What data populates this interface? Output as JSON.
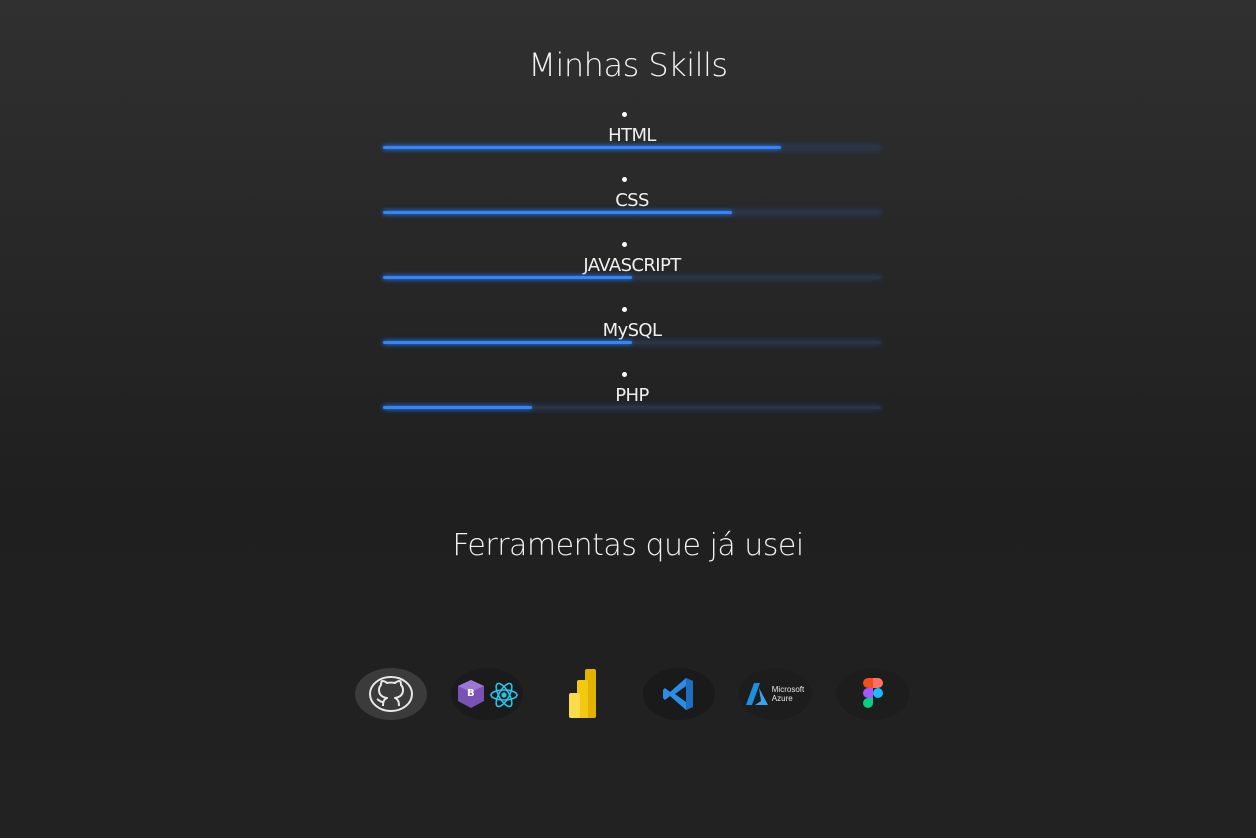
{
  "skills": {
    "title": "Minhas Skills",
    "items": [
      {
        "label": "HTML",
        "level": 0.8
      },
      {
        "label": "CSS",
        "level": 0.7
      },
      {
        "label": "JAVASCRIPT",
        "level": 0.5
      },
      {
        "label": "MySQL",
        "level": 0.5
      },
      {
        "label": "PHP",
        "level": 0.3
      }
    ]
  },
  "tools": {
    "title": "Ferramentas que já usei",
    "azure_line1": "Microsoft",
    "azure_line2": "Azure",
    "icons": [
      "github-icon",
      "bootstrap-icon",
      "react-icon",
      "power-bi-icon",
      "vscode-icon",
      "azure-icon",
      "figma-icon"
    ]
  },
  "colors": {
    "background": "#2a2a2a",
    "bar_fill": "#2f86ff",
    "bar_track": "#2b3540",
    "text": "#f2f2f2"
  }
}
